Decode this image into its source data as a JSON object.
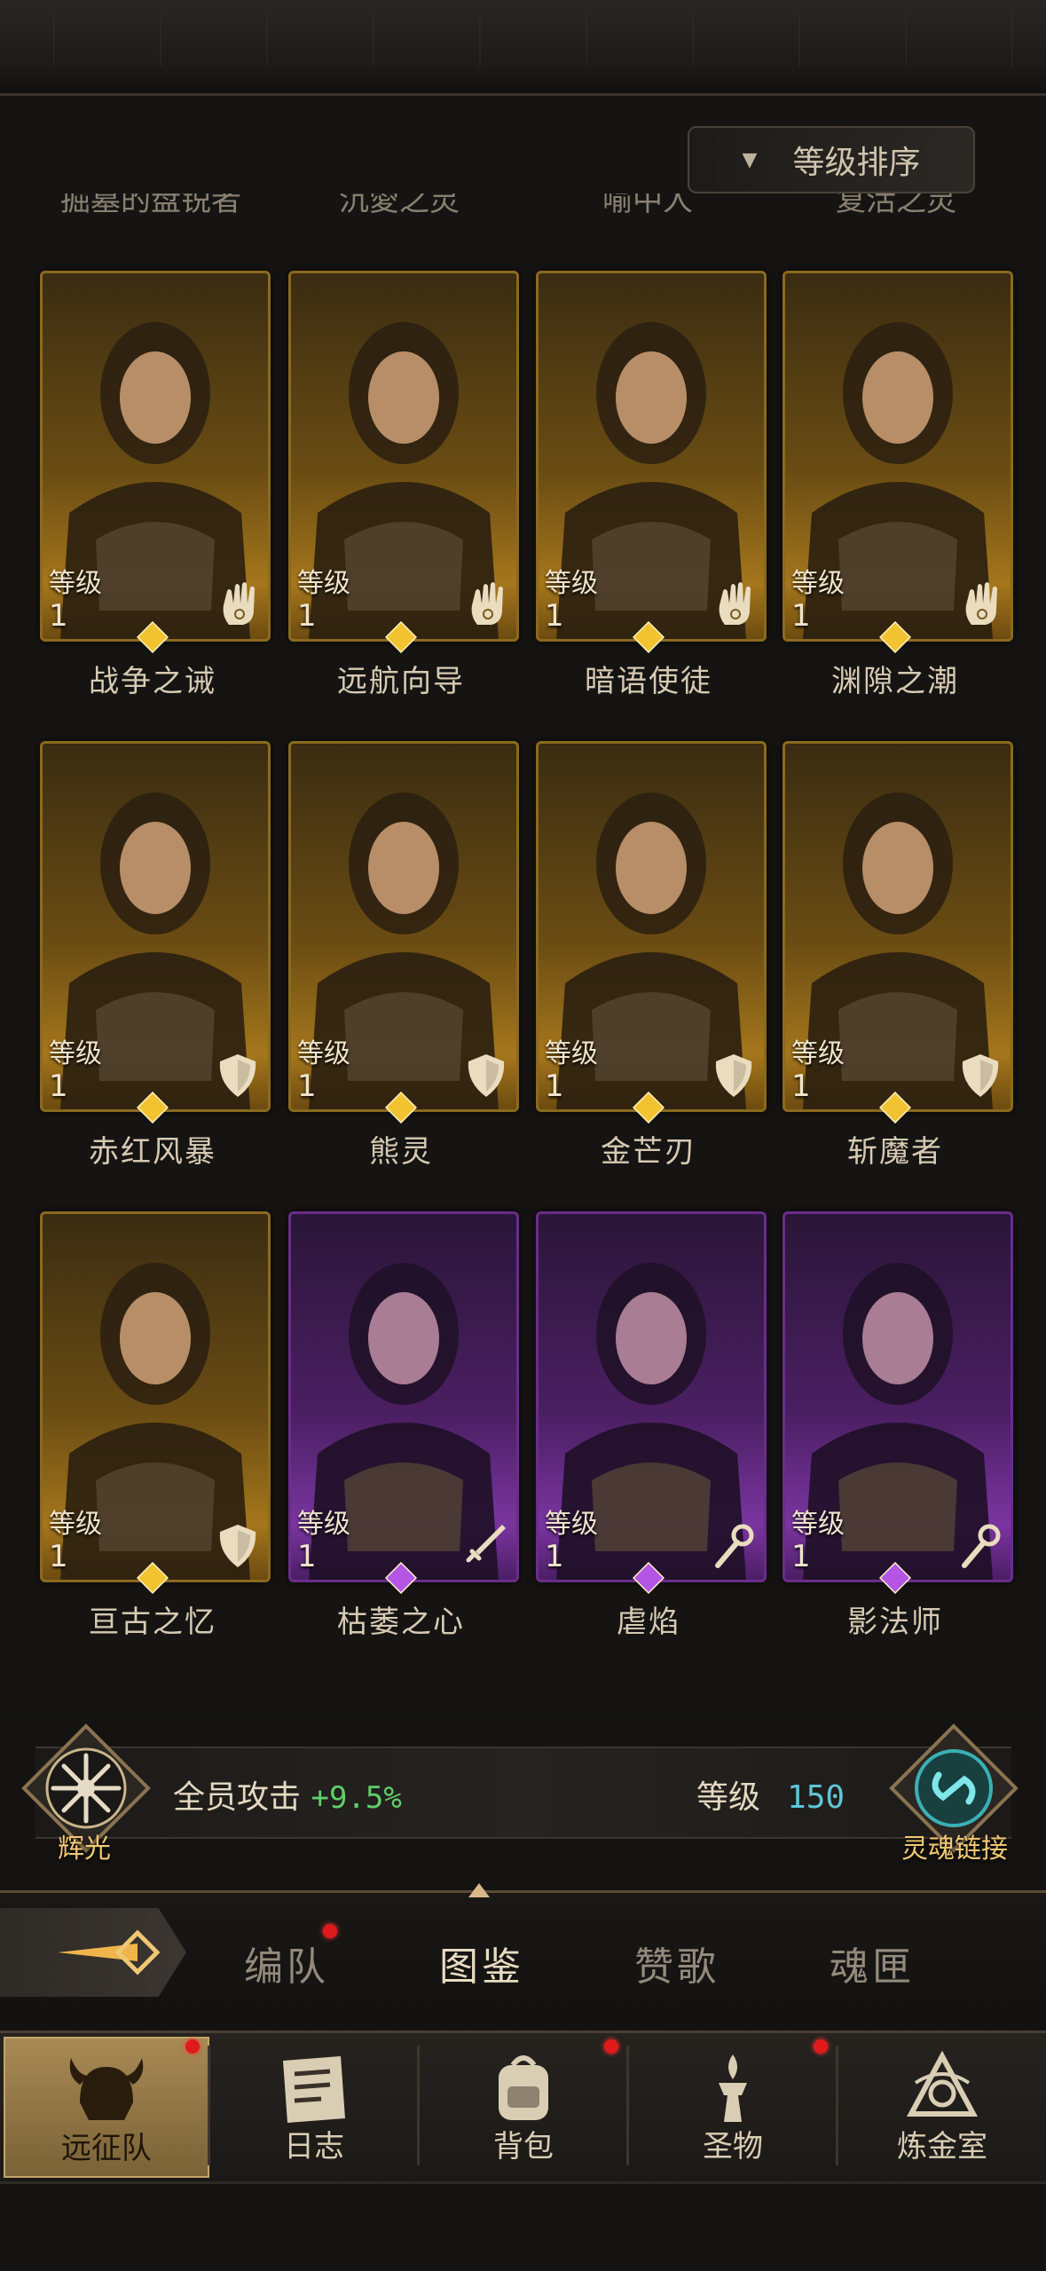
{
  "sort": {
    "label": "等级排序"
  },
  "cut_row_names": [
    "掘墓的盘锐者",
    "沉愛之灵",
    "喻中人",
    "复活之灵"
  ],
  "level_label": "等级",
  "heroes": [
    {
      "name": "战争之诫",
      "level": "1",
      "rarity": "gold",
      "class": "hand"
    },
    {
      "name": "远航向导",
      "level": "1",
      "rarity": "gold",
      "class": "hand"
    },
    {
      "name": "暗语使徒",
      "level": "1",
      "rarity": "gold",
      "class": "hand"
    },
    {
      "name": "渊隙之潮",
      "level": "1",
      "rarity": "gold",
      "class": "hand"
    },
    {
      "name": "赤红风暴",
      "level": "1",
      "rarity": "gold",
      "class": "shield"
    },
    {
      "name": "熊灵",
      "level": "1",
      "rarity": "gold",
      "class": "shield"
    },
    {
      "name": "金芒刃",
      "level": "1",
      "rarity": "gold",
      "class": "shield"
    },
    {
      "name": "斩魔者",
      "level": "1",
      "rarity": "gold",
      "class": "shield"
    },
    {
      "name": "亘古之忆",
      "level": "1",
      "rarity": "gold",
      "class": "shield"
    },
    {
      "name": "枯萎之心",
      "level": "1",
      "rarity": "purple",
      "class": "sword"
    },
    {
      "name": "虐焰",
      "level": "1",
      "rarity": "purple",
      "class": "staff"
    },
    {
      "name": "影法师",
      "level": "1",
      "rarity": "purple",
      "class": "staff"
    }
  ],
  "bonus": {
    "emblem_label": "辉光",
    "text": "全员攻击",
    "value": "+9.5%"
  },
  "soul_link": {
    "level_label": "等级",
    "level_value": "150",
    "emblem_label": "灵魂链接"
  },
  "tabs": [
    {
      "label": "编队",
      "badge": true
    },
    {
      "label": "图鉴",
      "badge": false,
      "active": true
    },
    {
      "label": "赞歌",
      "badge": false
    },
    {
      "label": "魂匣",
      "badge": false
    }
  ],
  "nav": [
    {
      "label": "远征队",
      "icon": "helmet-icon",
      "active": true,
      "badge": true
    },
    {
      "label": "日志",
      "icon": "journal-icon",
      "active": false,
      "badge": false
    },
    {
      "label": "背包",
      "icon": "backpack-icon",
      "active": false,
      "badge": true
    },
    {
      "label": "圣物",
      "icon": "relic-icon",
      "active": false,
      "badge": true
    },
    {
      "label": "炼金室",
      "icon": "alchemy-icon",
      "active": false,
      "badge": false
    }
  ],
  "colors": {
    "gold": "#a5761c",
    "purple": "#7a35a0",
    "bonus_green": "#5fcf6b",
    "level_cyan": "#5fc5d9",
    "emblem_gold": "#f0c873"
  }
}
